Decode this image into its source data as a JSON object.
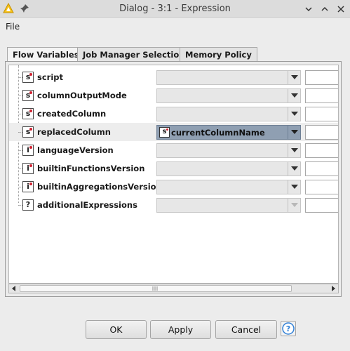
{
  "window": {
    "title": "Dialog - 3:1 - Expression"
  },
  "menu": {
    "file": "File"
  },
  "tabs": [
    "Flow Variables",
    "Job Manager Selection",
    "Memory Policy"
  ],
  "rows": [
    {
      "type": "s",
      "name": "script",
      "value": "",
      "enabled": true
    },
    {
      "type": "s",
      "name": "columnOutputMode",
      "value": "",
      "enabled": true
    },
    {
      "type": "s",
      "name": "createdColumn",
      "value": "",
      "enabled": true
    },
    {
      "type": "s",
      "name": "replacedColumn",
      "value": "currentColumnName",
      "enabled": true
    },
    {
      "type": "i",
      "name": "languageVersion",
      "value": "",
      "enabled": true
    },
    {
      "type": "i",
      "name": "builtinFunctionsVersion",
      "value": "",
      "enabled": true
    },
    {
      "type": "i",
      "name": "builtinAggregationsVersion",
      "value": "",
      "enabled": true
    },
    {
      "type": "?",
      "name": "additionalExpressions",
      "value": "",
      "enabled": false
    }
  ],
  "buttons": {
    "ok": "OK",
    "apply": "Apply",
    "cancel": "Cancel"
  },
  "colors": {
    "accent": "#2f7fd6",
    "variable_dot": "#d0202f",
    "selected_combo": "#8f9fb2"
  }
}
